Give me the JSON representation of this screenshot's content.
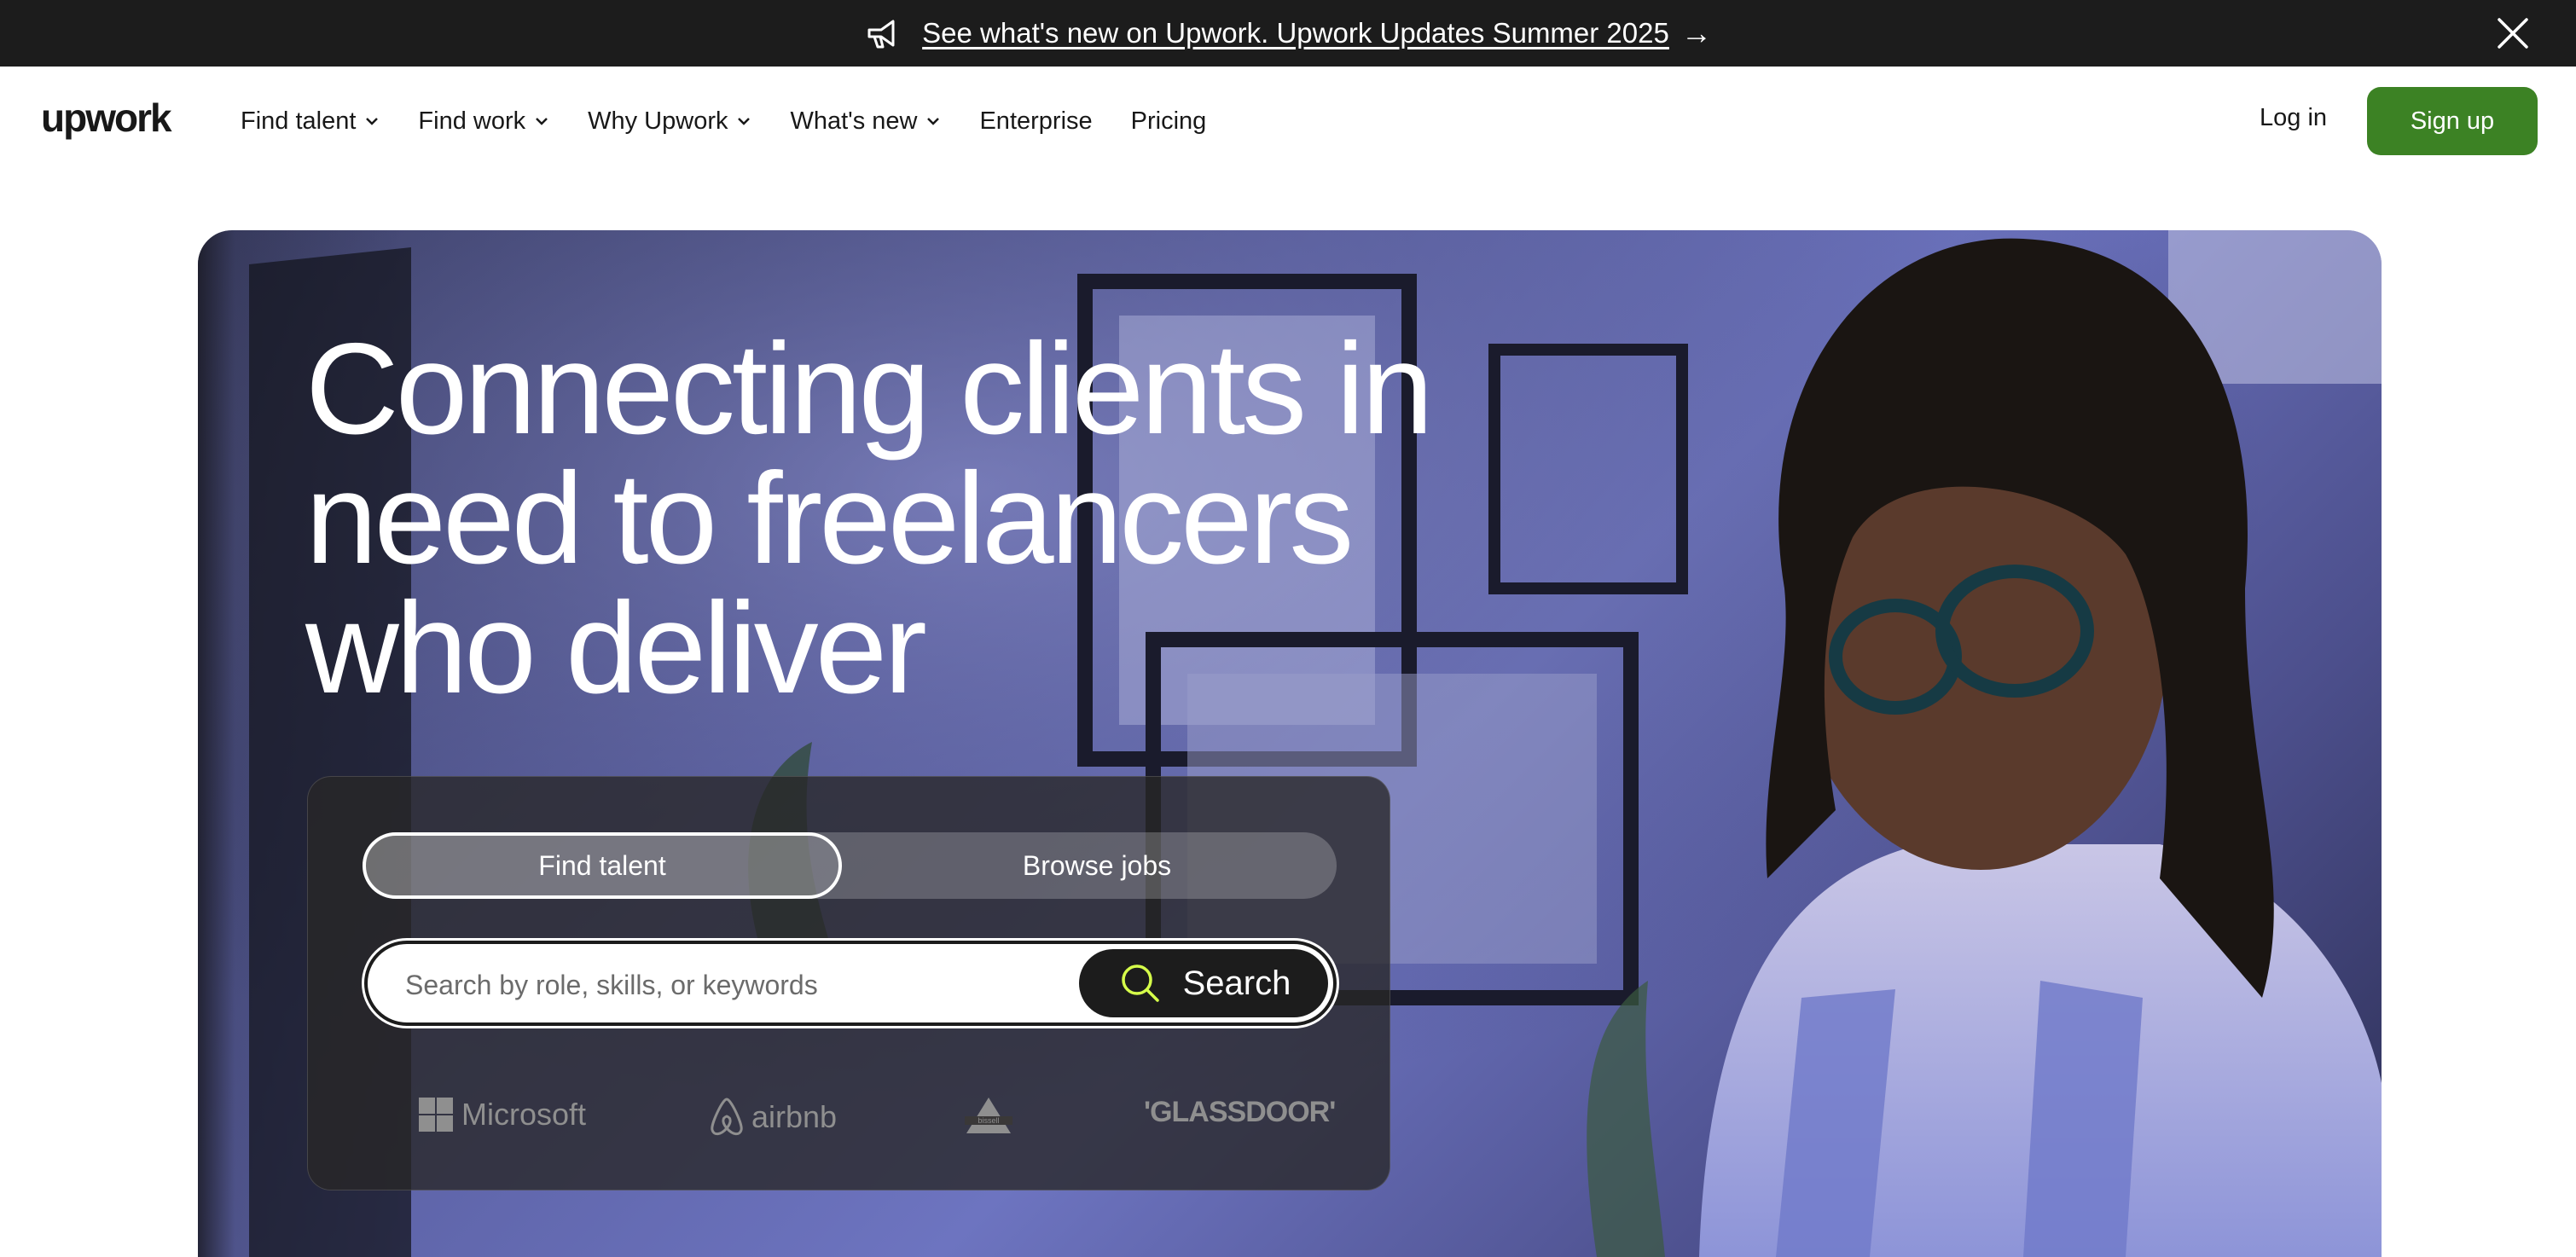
{
  "announcement": {
    "link_text": "See what's new on Upwork. Upwork Updates Summer 2025",
    "arrow": "→"
  },
  "header": {
    "logo_text": "upwork",
    "nav": [
      {
        "label": "Find talent",
        "has_dropdown": true
      },
      {
        "label": "Find work",
        "has_dropdown": true
      },
      {
        "label": "Why Upwork",
        "has_dropdown": true
      },
      {
        "label": "What's new",
        "has_dropdown": true
      },
      {
        "label": "Enterprise",
        "has_dropdown": false
      },
      {
        "label": "Pricing",
        "has_dropdown": false
      }
    ],
    "login_label": "Log in",
    "signup_label": "Sign up"
  },
  "hero": {
    "headline": "Connecting clients in need to freelancers who deliver",
    "tabs": {
      "active": "Find talent",
      "inactive": "Browse jobs"
    },
    "search": {
      "placeholder": "Search by role, skills, or keywords",
      "value": "",
      "button_label": "Search"
    },
    "trusted_by": [
      {
        "name": "Microsoft",
        "icon": "microsoft-logo"
      },
      {
        "name": "airbnb",
        "icon": "airbnb-logo"
      },
      {
        "name": "bissell",
        "icon": "bissell-logo"
      },
      {
        "name": "'GLASSDOOR'",
        "icon": "glassdoor-logo"
      }
    ]
  },
  "colors": {
    "announcement_bg": "#1c1c1c",
    "brand_green": "#3c8224",
    "text_dark": "#181818",
    "search_button_bg": "#1c1c1c",
    "search_icon_accent": "#d6ff4a",
    "logo_gray": "#8f8f8f"
  }
}
